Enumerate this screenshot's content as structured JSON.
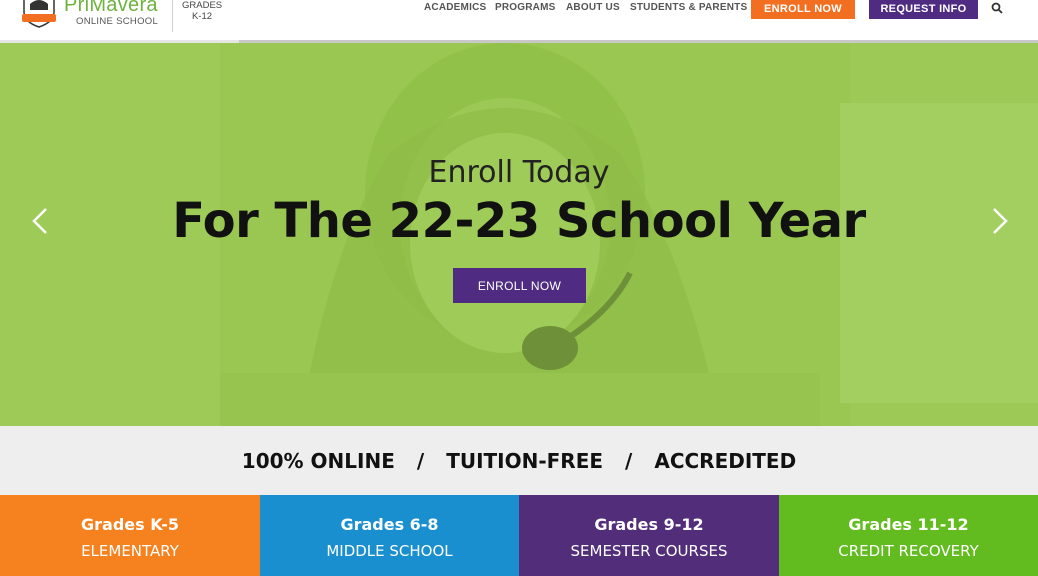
{
  "brand": {
    "name": "PriMavera",
    "sub": "ONLINE SCHOOL",
    "grades_line1": "GRADES",
    "grades_line2": "K-12"
  },
  "nav": {
    "items": [
      {
        "label": "ACADEMICS"
      },
      {
        "label": "PROGRAMS"
      },
      {
        "label": "ABOUT US"
      },
      {
        "label": "STUDENTS & PARENTS"
      }
    ],
    "enroll_label": "ENROLL NOW",
    "request_label": "REQUEST INFO"
  },
  "hero": {
    "subtitle": "Enroll Today",
    "title": "For The 22-23 School Year",
    "button_label": "ENROLL NOW",
    "slide_progress": 0.23
  },
  "tagline": {
    "items": [
      "100% ONLINE",
      "TUITION-FREE",
      "ACCREDITED"
    ],
    "separator": "/"
  },
  "tiles": [
    {
      "title": "Grades K-5",
      "sub": "ELEMENTARY",
      "color": "#f5821f"
    },
    {
      "title": "Grades 6-8",
      "sub": "MIDDLE SCHOOL",
      "color": "#1a8fcf"
    },
    {
      "title": "Grades 9-12",
      "sub": "SEMESTER COURSES",
      "color": "#512d7a"
    },
    {
      "title": "Grades 11-12",
      "sub": "CREDIT RECOVERY",
      "color": "#62bb1f"
    }
  ],
  "colors": {
    "orange": "#f26f21",
    "purple": "#4f2c82",
    "green": "#6cb33e"
  },
  "icons": {
    "logo": "primavera-logo-icon",
    "search": "search-icon",
    "prev": "chevron-left-icon",
    "next": "chevron-right-icon"
  }
}
